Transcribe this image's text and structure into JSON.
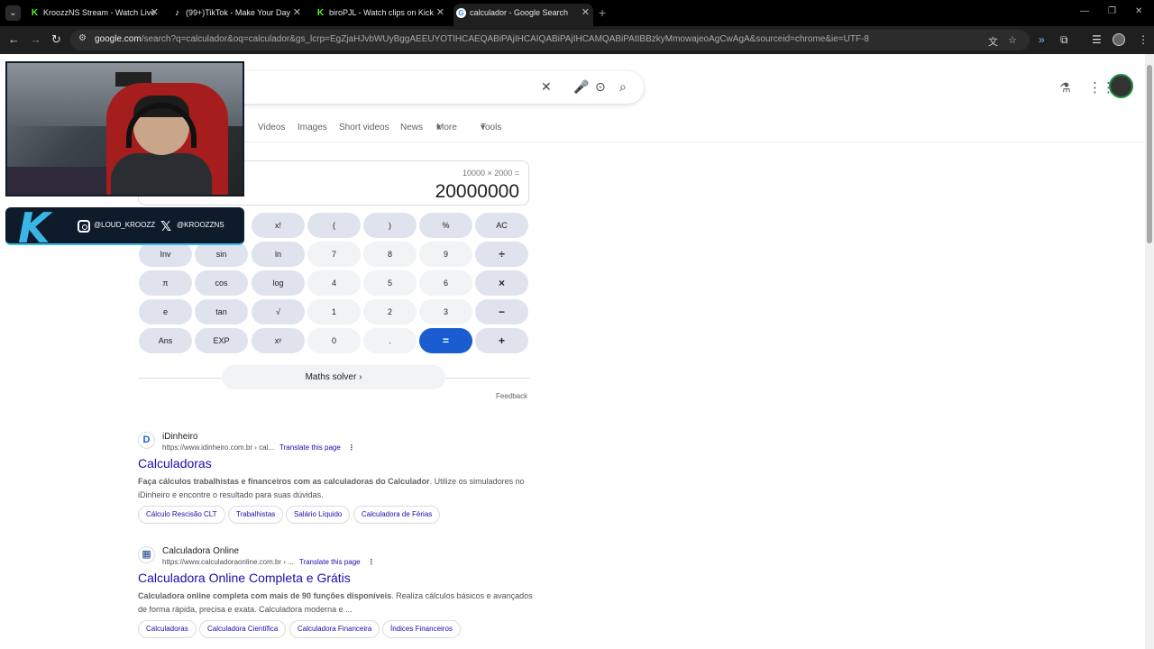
{
  "browser": {
    "tabs": [
      {
        "title": "KroozzNS Stream - Watch Live",
        "favicon": "kick-icon"
      },
      {
        "title": "(99+)TikTok - Make Your Day",
        "favicon": "tiktok-icon"
      },
      {
        "title": "biroPJL - Watch clips on Kick",
        "favicon": "kick-icon"
      },
      {
        "title": "calculador - Google Search",
        "favicon": "google-icon"
      }
    ],
    "url_domain": "google.com",
    "url_rest": "/search?q=calculador&oq=calculador&gs_lcrp=EgZjaHJvbWUyBggAEEUYOTIHCAEQABiPAjIHCAIQABiPAjIHCAMQABiPAtIBBzkyMmowajeoAgCwAgA&sourceid=chrome&ie=UTF-8"
  },
  "nav_tabs": [
    "Videos",
    "Images",
    "Short videos",
    "News",
    "More",
    "Tools"
  ],
  "calculator": {
    "expression": "10000 × 2000 =",
    "result": "20000000",
    "rows": [
      [
        "x!",
        "(",
        ")",
        "%",
        "AC"
      ],
      [
        "Inv",
        "sin",
        "ln",
        "7",
        "8",
        "9",
        "÷"
      ],
      [
        "π",
        "cos",
        "log",
        "4",
        "5",
        "6",
        "×"
      ],
      [
        "e",
        "tan",
        "√",
        "1",
        "2",
        "3",
        "−"
      ],
      [
        "Ans",
        "EXP",
        "xʸ",
        "0",
        ".",
        "=",
        "+"
      ]
    ],
    "solver_label": "Maths solver",
    "feedback_label": "Feedback"
  },
  "results": [
    {
      "site": "iDinheiro",
      "url": "https://www.idinheiro.com.br › cal...",
      "translate": "Translate this page",
      "title": "Calculadoras",
      "snippet_bold": "Faça cálculos trabalhistas e financeiros com as calculadoras do Calculador",
      "snippet": ". Utilize os simuladores no iDinheiro e encontre o resultado para suas dúvidas.",
      "chips": [
        "Cálculo Rescisão CLT",
        "Trabalhistas",
        "Salário Líquido",
        "Calculadora de Férias"
      ]
    },
    {
      "site": "Calculadora Online",
      "url": "https://www.calculadoraonline.com.br › ...",
      "translate": "Translate this page",
      "title": "Calculadora Online Completa e Grátis",
      "snippet_bold": "Calculadora online completa com mais de 90 funções disponíveis",
      "snippet": ". Realiza cálculos básicos e avançados de forma rápida, precisa e exata. Calculadora moderna e ...",
      "chips": [
        "Calculadoras",
        "Calculadora Científica",
        "Calculadora Financeira",
        "Índices Financeiros"
      ]
    }
  ],
  "overlay": {
    "instagram": "@LOUD_KROOZZ",
    "x_handle": "@KROOZZNS",
    "logo_letter": "K"
  },
  "colors": {
    "accent": "#1a5dd1",
    "link": "#1a0dab",
    "overlay_bg": "#0d1b2a",
    "overlay_accent": "#36c1e8"
  }
}
